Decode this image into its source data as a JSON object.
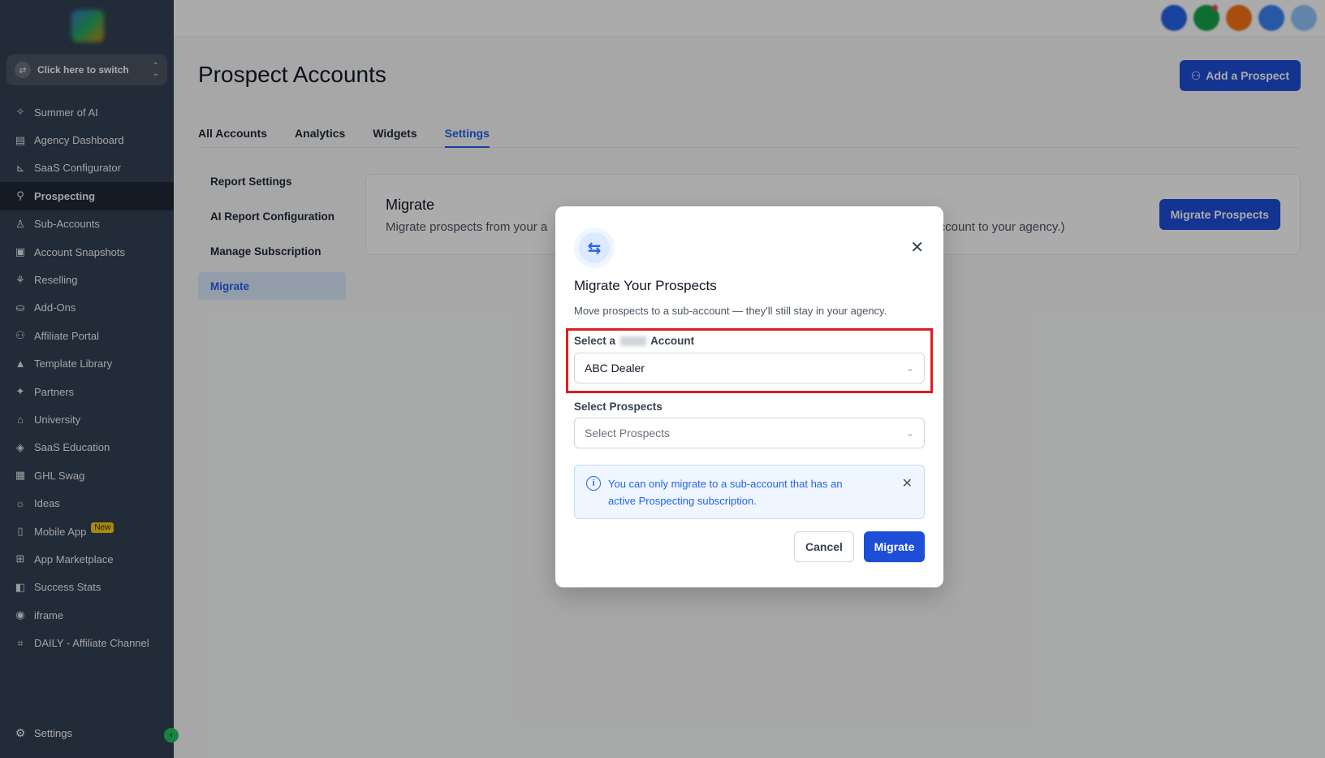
{
  "app": {
    "switcher_label": "Click here to switch"
  },
  "sidebar": {
    "items": [
      {
        "label": "Summer of AI",
        "icon": "sparkle-icon"
      },
      {
        "label": "Agency Dashboard",
        "icon": "dashboard-icon"
      },
      {
        "label": "SaaS Configurator",
        "icon": "chart-icon"
      },
      {
        "label": "Prospecting",
        "icon": "user-search-icon",
        "active": true
      },
      {
        "label": "Sub-Accounts",
        "icon": "user-icon"
      },
      {
        "label": "Account Snapshots",
        "icon": "snapshot-icon"
      },
      {
        "label": "Reselling",
        "icon": "reselling-icon"
      },
      {
        "label": "Add-Ons",
        "icon": "bag-icon"
      },
      {
        "label": "Affiliate Portal",
        "icon": "users-icon"
      },
      {
        "label": "Template Library",
        "icon": "shapes-icon"
      },
      {
        "label": "Partners",
        "icon": "handshake-icon"
      },
      {
        "label": "University",
        "icon": "graduation-cap-icon"
      },
      {
        "label": "SaaS Education",
        "icon": "cube-icon"
      },
      {
        "label": "GHL Swag",
        "icon": "store-icon"
      },
      {
        "label": "Ideas",
        "icon": "lightbulb-icon"
      },
      {
        "label": "Mobile App",
        "icon": "mobile-icon",
        "badge": "New"
      },
      {
        "label": "App Marketplace",
        "icon": "grid-icon"
      },
      {
        "label": "Success Stats",
        "icon": "stats-icon"
      },
      {
        "label": "iframe",
        "icon": "vr-icon"
      },
      {
        "label": "DAILY - Affiliate Channel",
        "icon": "frame-icon"
      }
    ],
    "settings_label": "Settings"
  },
  "header": {
    "page_title": "Prospect Accounts",
    "add_button": "Add a Prospect"
  },
  "tabs": [
    "All Accounts",
    "Analytics",
    "Widgets",
    "Settings"
  ],
  "active_tab": "Settings",
  "subnav": [
    "Report Settings",
    "AI Report Configuration",
    "Manage Subscription",
    "Migrate"
  ],
  "active_subnav": "Migrate",
  "card": {
    "title": "Migrate",
    "desc_start": "Migrate prospects from your a",
    "desc_end": "b-account to your agency.)",
    "button": "Migrate Prospects"
  },
  "modal": {
    "title": "Migrate Your Prospects",
    "description": "Move prospects to a sub-account — they'll still stay in your agency.",
    "account_label_prefix": "Select a",
    "account_label_suffix": "Account",
    "account_value": "ABC Dealer",
    "prospects_label": "Select Prospects",
    "prospects_placeholder": "Select Prospects",
    "info_text": "You can only migrate to a sub-account that has an active Prospecting subscription.",
    "cancel": "Cancel",
    "migrate": "Migrate"
  },
  "colors": {
    "primary": "#1d4ed8",
    "sidebar": "#344054",
    "highlight": "#e11d1d"
  }
}
